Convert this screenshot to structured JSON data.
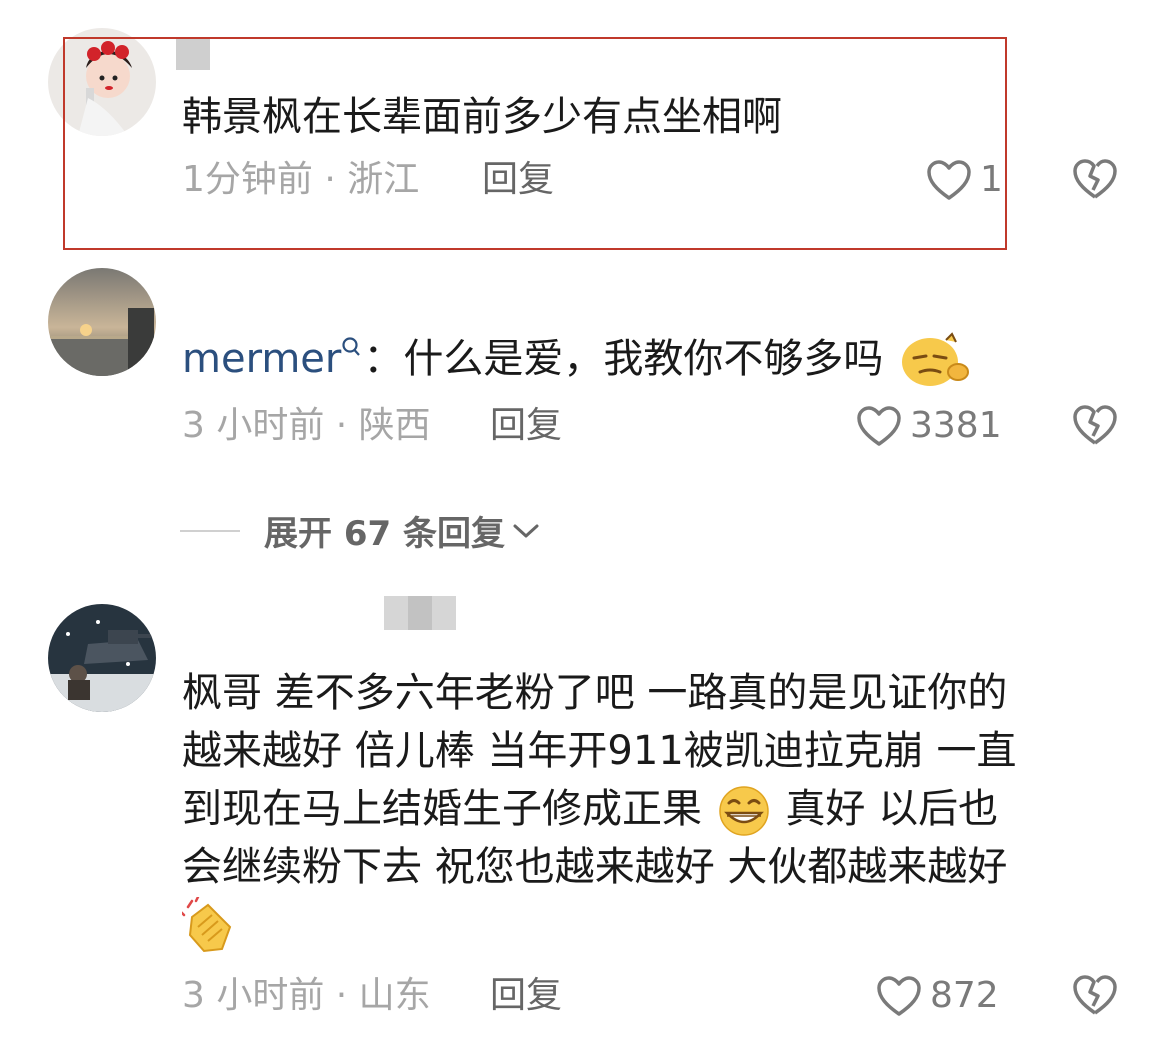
{
  "comments": [
    {
      "text": "韩景枫在长辈面前多少有点坐相啊",
      "meta": "1分钟前 · 浙江",
      "reply_label": "回复",
      "likes": "1"
    },
    {
      "username": "mermer",
      "separator": "：",
      "text": "什么是爱，我教你不够多吗",
      "meta": "3 小时前 · 陕西",
      "reply_label": "回复",
      "likes": "3381",
      "expand_label": "展开 67 条回复"
    },
    {
      "text_lines": [
        "枫哥  差不多六年老粉了吧  一路真的是见证你的",
        "越来越好  倍儿棒  当年开911被凯迪拉克崩  一直",
        "到现在马上结婚生子修成正果",
        "真好  以后也",
        "会继续粉下去  祝您也越来越好  大伙都越来越好"
      ],
      "meta": "3 小时前 · 山东",
      "reply_label": "回复",
      "likes": "872"
    }
  ],
  "colors": {
    "highlight": "#c0392b",
    "username": "#2b4f7e",
    "meta": "#a6a6a6"
  },
  "icons": [
    "heart-outline-icon",
    "broken-heart-icon",
    "chevron-down-icon",
    "search-icon",
    "smirk-emoji",
    "grin-emoji",
    "clap-emoji"
  ]
}
